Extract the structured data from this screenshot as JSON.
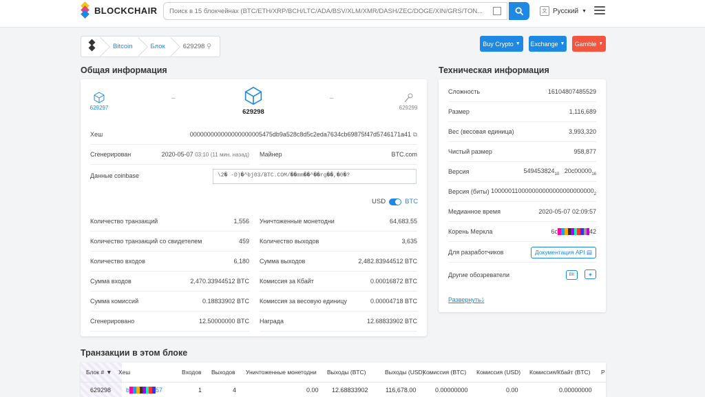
{
  "header": {
    "brand": "BLOCKCHAIR",
    "search_placeholder": "Поиск в 15 блокчейнах (BTC/ETH/XRP/BCH/LTC/ADA/BSV/XLM/XMR/DASH/ZEC/DOGE/XIN/GRS/TON...",
    "language": "Русский",
    "colors": {
      "accent": "#1e88e5",
      "buy": "#1e88e5",
      "gamble": "#f4553c"
    }
  },
  "breadcrumb": [
    "Bitcoin",
    "Блок",
    "629298"
  ],
  "actions": {
    "buy": "Buy Crypto",
    "exchange": "Exchange",
    "gamble": "Gamble"
  },
  "general": {
    "title": "Общая информация",
    "prev_block": "629297",
    "current_block": "629298",
    "next_block": "629299",
    "dash": "–",
    "hash_label": "Хеш",
    "hash_value": "000000000000000000005475db9a528c8d5c2eda7634cb69875f47d5746171a41",
    "generated_label": "Сгенерирован",
    "generated_value": "2020-05-07",
    "generated_time": "03:10",
    "generated_ago": "(11 мин. назад)",
    "miner_label": "Майнер",
    "miner_value": "BTC.com",
    "coinbase_label": "Данные coinbase",
    "coinbase_value": "\\2�    -D)�^bj03/BTC.COM/��mm��^��rg��,�0�?",
    "toggle_left": "USD",
    "toggle_right": "BTC",
    "left_rows": [
      {
        "label": "Количество транзакций",
        "value": "1,556"
      },
      {
        "label": "Количество транзакций со свидетелем",
        "value": "459"
      },
      {
        "label": "Количество входов",
        "value": "6,180"
      },
      {
        "label": "Сумма входов",
        "value": "2,470.33944512 BTC"
      },
      {
        "label": "Сумма комиссий",
        "value": "0.18833902 BTC"
      },
      {
        "label": "Сгенерировано",
        "value": "12.50000000 BTC"
      }
    ],
    "right_rows": [
      {
        "label": "Уничтоженные монетодни",
        "value": "64,683.55"
      },
      {
        "label": "Количество выходов",
        "value": "3,635"
      },
      {
        "label": "Сумма выходов",
        "value": "2,482.83944512 BTC"
      },
      {
        "label": "Комиссия за Кбайт",
        "value": "0.00016872 BTC"
      },
      {
        "label": "Комиссия за весовую единицу",
        "value": "0.00004718 BTC"
      },
      {
        "label": "Награда",
        "value": "12.68833902 BTC"
      }
    ]
  },
  "tech": {
    "title": "Техническая информация",
    "rows": [
      {
        "label": "Сложность",
        "value": "16104807485529"
      },
      {
        "label": "Размер",
        "value": "1,116,689"
      },
      {
        "label": "Вес (весовая единица)",
        "value": "3,993,320"
      },
      {
        "label": "Чистый размер",
        "value": "958,877"
      },
      {
        "label": "Версия",
        "value": "549453824",
        "sub": "10",
        "value2": "20c00000",
        "sub2": "16"
      },
      {
        "label": "Версия (биты)",
        "value": "100000110000000000000000000000",
        "sub": "2"
      },
      {
        "label": "Медианное время",
        "value": "2020-05-07 02:09:57"
      },
      {
        "label": "Корень Меркла",
        "prefix": "6c",
        "suffix": "42"
      }
    ],
    "dev_label": "Для разработчиков",
    "api_label": "Документация API",
    "explorers_label": "Другие обозреватели",
    "explorer_btn": "ВК",
    "expand": "Развернуть"
  },
  "transactions": {
    "title": "Транзакции в этом блоке",
    "columns": [
      "Блок #",
      "Хеш",
      "Входов",
      "Выходов",
      "Уничтоженные монетодни",
      "Выходы (BTC)",
      "Выходы (USD)",
      "Комиссия (BTC)",
      "Комиссия (USD)",
      "Комиссия/Кбайт (BTC)",
      "Р"
    ],
    "row": {
      "block": "629298",
      "hash_prefix": "b",
      "hash_suffix": "57",
      "inputs": "1",
      "outputs": "4",
      "cdd": "0.00",
      "out_btc": "12.68833902",
      "out_usd": "116,678.00",
      "fee_btc": "0.00000000",
      "fee_usd": "0.00",
      "fee_kb": "0.00000000"
    }
  }
}
